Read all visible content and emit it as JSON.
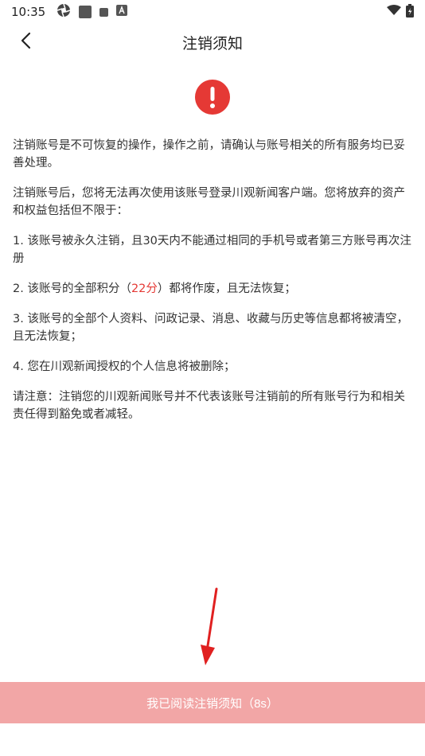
{
  "status_bar": {
    "time": "10:35",
    "icons_left": [
      "aperture-icon",
      "app-square-icon",
      "small-square-icon",
      "a-badge-icon"
    ],
    "icons_right": [
      "wifi-icon",
      "battery-icon"
    ]
  },
  "nav": {
    "title": "注销须知",
    "back_icon": "chevron-left-icon"
  },
  "alert": {
    "icon": "exclamation-circle-icon",
    "color": "#e53935"
  },
  "content": {
    "p1": "注销账号是不可恢复的操作，操作之前，请确认与账号相关的所有服务均已妥善处理。",
    "p2": "注销账号后，您将无法再次使用该账号登录川观新闻客户端。您将放弃的资产和权益包括但不限于：",
    "p3": "1. 该账号被永久注销，且30天内不能通过相同的手机号或者第三方账号再次注册",
    "p4_prefix": "2. 该账号的全部积分（",
    "p4_points": "22分",
    "p4_suffix": "）都将作废，且无法恢复；",
    "p5": "3. 该账号的全部个人资料、问政记录、消息、收藏与历史等信息都将被清空，且无法恢复；",
    "p6": "4. 您在川观新闻授权的个人信息将被删除；",
    "p7": "请注意：注销您的川观新闻账号并不代表该账号注销前的所有账号行为和相关责任得到豁免或者减轻。"
  },
  "footer": {
    "confirm_label": "我已阅读注销须知（8s）",
    "button_color": "#f2a6a6"
  }
}
